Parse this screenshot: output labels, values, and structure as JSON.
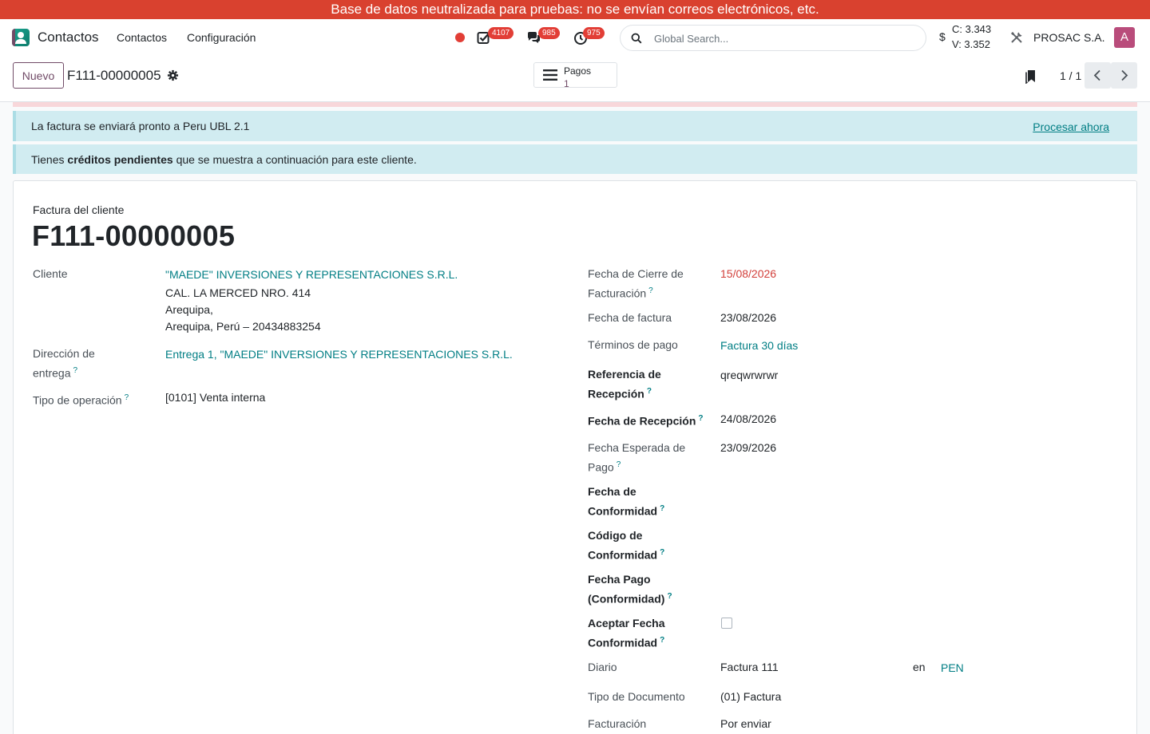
{
  "banner": "Base de datos neutralizada para pruebas: no se envían correos electrónicos, etc.",
  "navbar": {
    "app_name": "Contactos",
    "menu": [
      "Contactos",
      "Configuración"
    ],
    "activities_count": "4107",
    "messages_count": "985",
    "timer_count": "975",
    "search_placeholder": "Global Search...",
    "currency_symbol": "$",
    "rate_buy": "C: 3.343",
    "rate_sell": "V: 3.352",
    "company": "PROSAC S.A.",
    "avatar_letter": "A",
    "colors": {
      "banner": "#d9412f",
      "primary": "#714b67",
      "link": "#017e84",
      "badge": "#e23e36"
    }
  },
  "control_panel": {
    "new_button": "Nuevo",
    "record_name": "F111-00000005",
    "smart_button": {
      "label": "Pagos",
      "value": "1"
    },
    "pager": "1 / 1"
  },
  "alerts": {
    "ubl": {
      "text": "La factura se enviará pronto a Peru UBL 2.1",
      "action": "Procesar ahora"
    },
    "credits": {
      "prefix": "Tienes",
      "bold": "créditos pendientes",
      "suffix": "que se muestra a continuación para este cliente."
    }
  },
  "form": {
    "doc_type": "Factura del cliente",
    "doc_name": "F111-00000005",
    "left": {
      "cliente_label": "Cliente",
      "cliente_name": "\"MAEDE\" INVERSIONES Y REPRESENTACIONES S.R.L.",
      "address_1": "CAL. LA MERCED NRO. 414",
      "address_2": "Arequipa,",
      "address_3": "Arequipa, Perú – 20434883254",
      "delivery_label_1": "Dirección de",
      "delivery_label_2": "entrega",
      "delivery_value": "Entrega 1, \"MAEDE\" INVERSIONES Y REPRESENTACIONES S.R.L.",
      "operation_label": "Tipo de operación",
      "operation_value": "[0101] Venta interna"
    },
    "right": {
      "cierre_label_1": "Fecha de Cierre de",
      "cierre_label_2": "Facturación",
      "cierre_value": "15/08/2026",
      "fecha_factura_label": "Fecha de factura",
      "fecha_factura_value": "23/08/2026",
      "terminos_label": "Términos de pago",
      "terminos_value": "Factura 30 días",
      "ref_recepcion_label_1": "Referencia de",
      "ref_recepcion_label_2": "Recepción",
      "ref_recepcion_value": "qreqwrwrwr",
      "fecha_recepcion_label": "Fecha de Recepción",
      "fecha_recepcion_value": "24/08/2026",
      "fecha_esperada_label_1": "Fecha Esperada de",
      "fecha_esperada_label_2": "Pago",
      "fecha_esperada_value": "23/09/2026",
      "fecha_conformidad_label_1": "Fecha de",
      "fecha_conformidad_label_2": "Conformidad",
      "codigo_conformidad_label_1": "Código de",
      "codigo_conformidad_label_2": "Conformidad",
      "fecha_pago_label_1": "Fecha Pago",
      "fecha_pago_label_2": "(Conformidad)",
      "aceptar_label_1": "Aceptar Fecha",
      "aceptar_label_2": "Conformidad",
      "diario_label": "Diario",
      "diario_value": "Factura 111",
      "currency_sep": "en",
      "currency_value": "PEN",
      "tipo_doc_label": "Tipo de Documento",
      "tipo_doc_value": "(01) Factura",
      "facturacion_label": "Facturación",
      "facturacion_value": "Por enviar"
    },
    "help_mark": "?"
  }
}
